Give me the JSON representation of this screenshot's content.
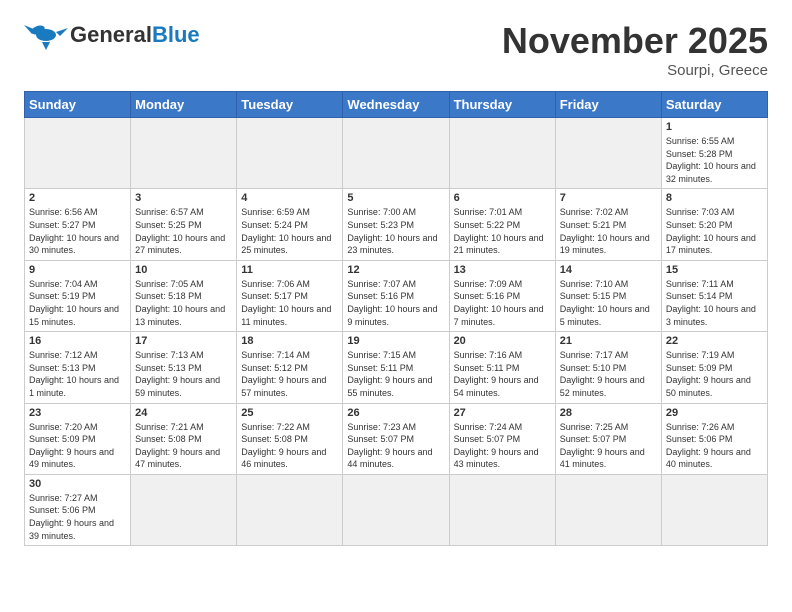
{
  "header": {
    "logo_general": "General",
    "logo_blue": "Blue",
    "title": "November 2025",
    "location": "Sourpi, Greece"
  },
  "weekdays": [
    "Sunday",
    "Monday",
    "Tuesday",
    "Wednesday",
    "Thursday",
    "Friday",
    "Saturday"
  ],
  "weeks": [
    [
      {
        "day": "",
        "empty": true
      },
      {
        "day": "",
        "empty": true
      },
      {
        "day": "",
        "empty": true
      },
      {
        "day": "",
        "empty": true
      },
      {
        "day": "",
        "empty": true
      },
      {
        "day": "",
        "empty": true
      },
      {
        "day": "1",
        "sunrise": "6:55 AM",
        "sunset": "5:28 PM",
        "daylight": "10 hours and 32 minutes."
      }
    ],
    [
      {
        "day": "2",
        "sunrise": "6:56 AM",
        "sunset": "5:27 PM",
        "daylight": "10 hours and 30 minutes."
      },
      {
        "day": "3",
        "sunrise": "6:57 AM",
        "sunset": "5:25 PM",
        "daylight": "10 hours and 27 minutes."
      },
      {
        "day": "4",
        "sunrise": "6:59 AM",
        "sunset": "5:24 PM",
        "daylight": "10 hours and 25 minutes."
      },
      {
        "day": "5",
        "sunrise": "7:00 AM",
        "sunset": "5:23 PM",
        "daylight": "10 hours and 23 minutes."
      },
      {
        "day": "6",
        "sunrise": "7:01 AM",
        "sunset": "5:22 PM",
        "daylight": "10 hours and 21 minutes."
      },
      {
        "day": "7",
        "sunrise": "7:02 AM",
        "sunset": "5:21 PM",
        "daylight": "10 hours and 19 minutes."
      },
      {
        "day": "8",
        "sunrise": "7:03 AM",
        "sunset": "5:20 PM",
        "daylight": "10 hours and 17 minutes."
      }
    ],
    [
      {
        "day": "9",
        "sunrise": "7:04 AM",
        "sunset": "5:19 PM",
        "daylight": "10 hours and 15 minutes."
      },
      {
        "day": "10",
        "sunrise": "7:05 AM",
        "sunset": "5:18 PM",
        "daylight": "10 hours and 13 minutes."
      },
      {
        "day": "11",
        "sunrise": "7:06 AM",
        "sunset": "5:17 PM",
        "daylight": "10 hours and 11 minutes."
      },
      {
        "day": "12",
        "sunrise": "7:07 AM",
        "sunset": "5:16 PM",
        "daylight": "10 hours and 9 minutes."
      },
      {
        "day": "13",
        "sunrise": "7:09 AM",
        "sunset": "5:16 PM",
        "daylight": "10 hours and 7 minutes."
      },
      {
        "day": "14",
        "sunrise": "7:10 AM",
        "sunset": "5:15 PM",
        "daylight": "10 hours and 5 minutes."
      },
      {
        "day": "15",
        "sunrise": "7:11 AM",
        "sunset": "5:14 PM",
        "daylight": "10 hours and 3 minutes."
      }
    ],
    [
      {
        "day": "16",
        "sunrise": "7:12 AM",
        "sunset": "5:13 PM",
        "daylight": "10 hours and 1 minute."
      },
      {
        "day": "17",
        "sunrise": "7:13 AM",
        "sunset": "5:13 PM",
        "daylight": "9 hours and 59 minutes."
      },
      {
        "day": "18",
        "sunrise": "7:14 AM",
        "sunset": "5:12 PM",
        "daylight": "9 hours and 57 minutes."
      },
      {
        "day": "19",
        "sunrise": "7:15 AM",
        "sunset": "5:11 PM",
        "daylight": "9 hours and 55 minutes."
      },
      {
        "day": "20",
        "sunrise": "7:16 AM",
        "sunset": "5:11 PM",
        "daylight": "9 hours and 54 minutes."
      },
      {
        "day": "21",
        "sunrise": "7:17 AM",
        "sunset": "5:10 PM",
        "daylight": "9 hours and 52 minutes."
      },
      {
        "day": "22",
        "sunrise": "7:19 AM",
        "sunset": "5:09 PM",
        "daylight": "9 hours and 50 minutes."
      }
    ],
    [
      {
        "day": "23",
        "sunrise": "7:20 AM",
        "sunset": "5:09 PM",
        "daylight": "9 hours and 49 minutes."
      },
      {
        "day": "24",
        "sunrise": "7:21 AM",
        "sunset": "5:08 PM",
        "daylight": "9 hours and 47 minutes."
      },
      {
        "day": "25",
        "sunrise": "7:22 AM",
        "sunset": "5:08 PM",
        "daylight": "9 hours and 46 minutes."
      },
      {
        "day": "26",
        "sunrise": "7:23 AM",
        "sunset": "5:07 PM",
        "daylight": "9 hours and 44 minutes."
      },
      {
        "day": "27",
        "sunrise": "7:24 AM",
        "sunset": "5:07 PM",
        "daylight": "9 hours and 43 minutes."
      },
      {
        "day": "28",
        "sunrise": "7:25 AM",
        "sunset": "5:07 PM",
        "daylight": "9 hours and 41 minutes."
      },
      {
        "day": "29",
        "sunrise": "7:26 AM",
        "sunset": "5:06 PM",
        "daylight": "9 hours and 40 minutes."
      }
    ],
    [
      {
        "day": "30",
        "sunrise": "7:27 AM",
        "sunset": "5:06 PM",
        "daylight": "9 hours and 39 minutes."
      },
      {
        "day": "",
        "empty": true
      },
      {
        "day": "",
        "empty": true
      },
      {
        "day": "",
        "empty": true
      },
      {
        "day": "",
        "empty": true
      },
      {
        "day": "",
        "empty": true
      },
      {
        "day": "",
        "empty": true
      }
    ]
  ],
  "labels": {
    "sunrise": "Sunrise:",
    "sunset": "Sunset:",
    "daylight": "Daylight:"
  }
}
